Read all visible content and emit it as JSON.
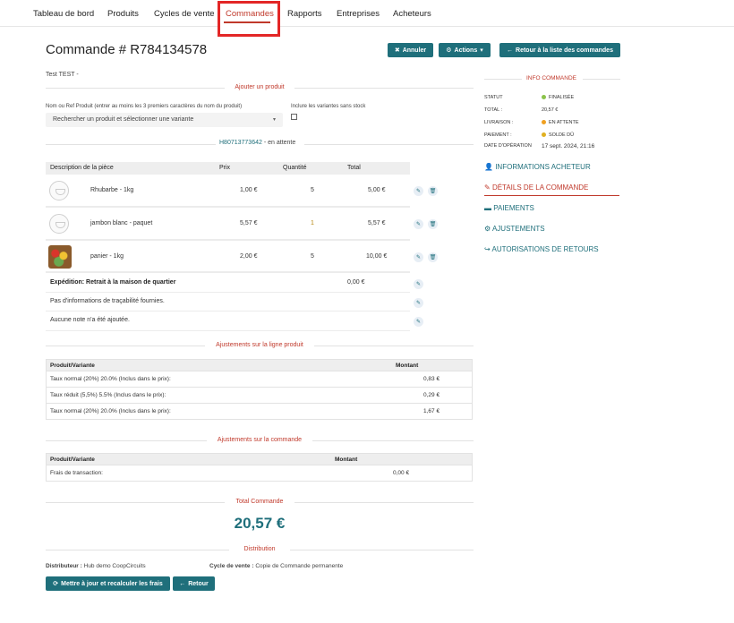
{
  "nav": {
    "items": [
      "Tableau de bord",
      "Produits",
      "Cycles de vente",
      "Commandes",
      "Rapports",
      "Entreprises",
      "Acheteurs"
    ],
    "active": "Commandes"
  },
  "header": {
    "title": "Commande # R784134578",
    "subtitle": "Test TEST -",
    "cancel_label": "Annuler",
    "actions_label": "Actions",
    "back_list_label": "Retour à la liste des commandes"
  },
  "add_product": {
    "section_title": "Ajouter un produit",
    "search_label": "Nom ou Ref Produit (entrer au moins les 3 premiers caractères du nom du produit)",
    "include_label": "Inclure les variantes sans stock",
    "select_placeholder": "Rechercher un produit et sélectionner une variante"
  },
  "shipment": {
    "number": "H80713773642",
    "status": "- en attente"
  },
  "items_table": {
    "headers": {
      "desc": "Description de la pièce",
      "price": "Prix",
      "qty": "Quantité",
      "total": "Total"
    },
    "rows": [
      {
        "name": "Rhubarbe - 1kg",
        "price": "1,00 €",
        "qty": "5",
        "total": "5,00 €"
      },
      {
        "name": "jambon blanc - paquet",
        "price": "5,57 €",
        "qty": "1",
        "total": "5,57 €"
      },
      {
        "name": "panier - 1kg",
        "price": "2,00 €",
        "qty": "5",
        "total": "10,00 €"
      }
    ],
    "shipping_label": "Expédition: Retrait à la maison de quartier",
    "shipping_value": "0,00 €",
    "traceability": "Pas d'informations de traçabilité fournies.",
    "note": "Aucune note n'a été ajoutée."
  },
  "line_adjustments": {
    "section_title": "Ajustements sur la ligne produit",
    "headers": {
      "variant": "Produit/Variante",
      "amount": "Montant"
    },
    "rows": [
      {
        "label": "Taux normal (20%) 20.0% (Inclus dans le prix):",
        "amount": "0,83 €"
      },
      {
        "label": "Taux réduit (5,5%) 5.5% (Inclus dans le prix):",
        "amount": "0,29 €"
      },
      {
        "label": "Taux normal (20%) 20.0% (Inclus dans le prix):",
        "amount": "1,67 €"
      }
    ]
  },
  "order_adjustments": {
    "section_title": "Ajustements sur la commande",
    "headers": {
      "variant": "Produit/Variante",
      "amount": "Montant"
    },
    "rows": [
      {
        "label": "Frais de transaction:",
        "amount": "0,00 €"
      }
    ]
  },
  "total": {
    "label": "Total Commande",
    "value": "20,57 €"
  },
  "distribution": {
    "section_title": "Distribution",
    "distributor_label": "Distributeur :",
    "distributor_value": "Hub demo CoopCircuits",
    "cycle_label": "Cycle de vente :",
    "cycle_value": "Copie de Commande permanente",
    "update_button": "Mettre à jour et recalculer les frais",
    "back_button": "Retour"
  },
  "sidebar": {
    "title": "INFO COMMANDE",
    "fields": [
      {
        "key": "STATUT",
        "value": "FINALISÉE",
        "dot": "#8bc34a"
      },
      {
        "key": "TOTAL :",
        "value": "20,57 €",
        "dot": ""
      },
      {
        "key": "LIVRAISON :",
        "value": "EN ATTENTE",
        "dot": "#f0a020"
      },
      {
        "key": "PAIEMENT :",
        "value": "SOLDE DÛ",
        "dot": "#e0b020"
      },
      {
        "key": "DATE D'OPÉRATION",
        "value": "17 sept. 2024, 21:16",
        "dot": ""
      }
    ],
    "links": [
      {
        "label": "INFORMATIONS ACHETEUR",
        "icon": "user-icon"
      },
      {
        "label": "DÉTAILS DE LA COMMANDE",
        "icon": "edit-icon"
      },
      {
        "label": "PAIEMENTS",
        "icon": "credit-card-icon"
      },
      {
        "label": "AJUSTEMENTS",
        "icon": "cogs-icon"
      },
      {
        "label": "AUTORISATIONS DE RETOURS",
        "icon": "share-icon"
      }
    ],
    "active_link": "DÉTAILS DE LA COMMANDE"
  },
  "colors": {
    "teal": "#1f6f7b",
    "accent_red": "#c0392b",
    "highlight_box": "#e32626"
  }
}
